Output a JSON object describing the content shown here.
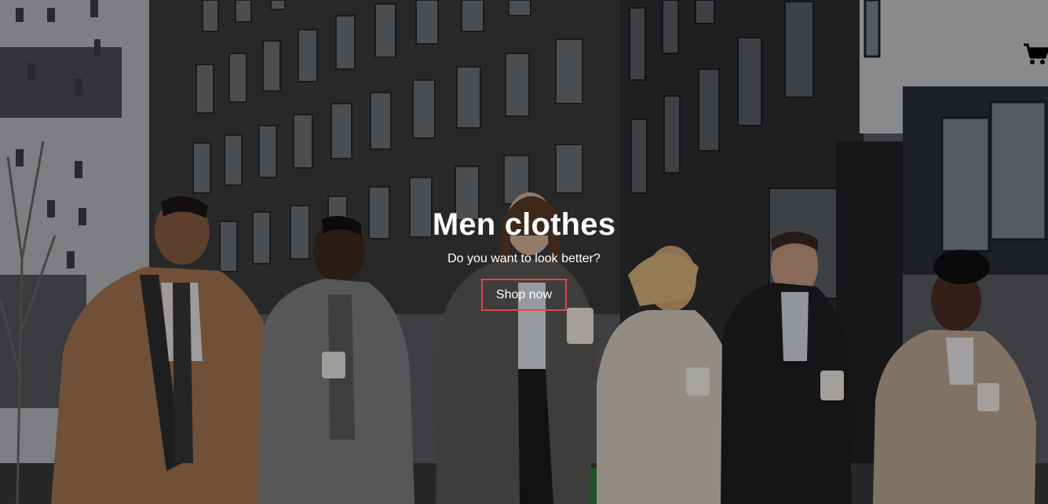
{
  "hero": {
    "title": "Men clothes",
    "subtitle": "Do you want to look better?",
    "button_label": "Shop now",
    "accent_color": "#e0484b"
  },
  "header": {
    "cart_icon": "shopping-cart-icon"
  }
}
